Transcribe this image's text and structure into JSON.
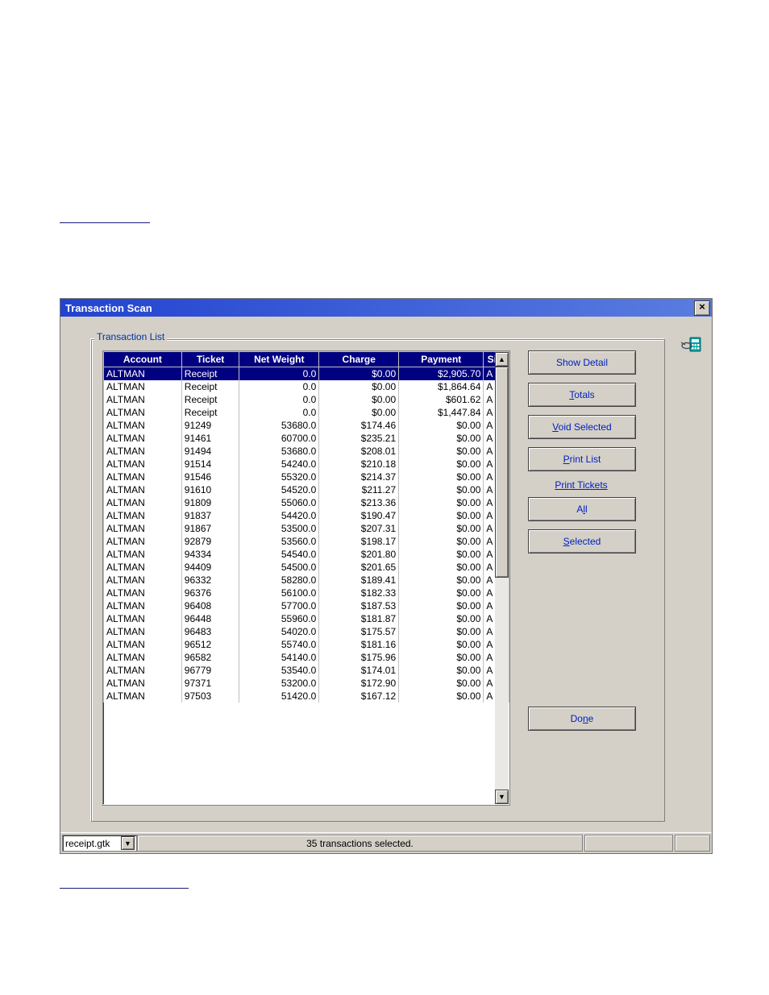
{
  "window": {
    "title": "Transaction Scan",
    "group_label": "Transaction List"
  },
  "columns": {
    "account": "Account",
    "ticket": "Ticket",
    "netweight": "Net Weight",
    "charge": "Charge",
    "payment": "Payment",
    "site": "Site"
  },
  "rows": [
    {
      "selected": true,
      "account": "ALTMAN",
      "ticket": "Receipt",
      "netwt": "0.0",
      "charge": "$0.00",
      "payment": "$2,905.70",
      "site": "A"
    },
    {
      "selected": false,
      "account": "ALTMAN",
      "ticket": "Receipt",
      "netwt": "0.0",
      "charge": "$0.00",
      "payment": "$1,864.64",
      "site": "A"
    },
    {
      "selected": false,
      "account": "ALTMAN",
      "ticket": "Receipt",
      "netwt": "0.0",
      "charge": "$0.00",
      "payment": "$601.62",
      "site": "A"
    },
    {
      "selected": false,
      "account": "ALTMAN",
      "ticket": "Receipt",
      "netwt": "0.0",
      "charge": "$0.00",
      "payment": "$1,447.84",
      "site": "A"
    },
    {
      "selected": false,
      "account": "ALTMAN",
      "ticket": "91249",
      "netwt": "53680.0",
      "charge": "$174.46",
      "payment": "$0.00",
      "site": "A"
    },
    {
      "selected": false,
      "account": "ALTMAN",
      "ticket": "91461",
      "netwt": "60700.0",
      "charge": "$235.21",
      "payment": "$0.00",
      "site": "A"
    },
    {
      "selected": false,
      "account": "ALTMAN",
      "ticket": "91494",
      "netwt": "53680.0",
      "charge": "$208.01",
      "payment": "$0.00",
      "site": "A"
    },
    {
      "selected": false,
      "account": "ALTMAN",
      "ticket": "91514",
      "netwt": "54240.0",
      "charge": "$210.18",
      "payment": "$0.00",
      "site": "A"
    },
    {
      "selected": false,
      "account": "ALTMAN",
      "ticket": "91546",
      "netwt": "55320.0",
      "charge": "$214.37",
      "payment": "$0.00",
      "site": "A"
    },
    {
      "selected": false,
      "account": "ALTMAN",
      "ticket": "91610",
      "netwt": "54520.0",
      "charge": "$211.27",
      "payment": "$0.00",
      "site": "A"
    },
    {
      "selected": false,
      "account": "ALTMAN",
      "ticket": "91809",
      "netwt": "55060.0",
      "charge": "$213.36",
      "payment": "$0.00",
      "site": "A"
    },
    {
      "selected": false,
      "account": "ALTMAN",
      "ticket": "91837",
      "netwt": "54420.0",
      "charge": "$190.47",
      "payment": "$0.00",
      "site": "A"
    },
    {
      "selected": false,
      "account": "ALTMAN",
      "ticket": "91867",
      "netwt": "53500.0",
      "charge": "$207.31",
      "payment": "$0.00",
      "site": "A"
    },
    {
      "selected": false,
      "account": "ALTMAN",
      "ticket": "92879",
      "netwt": "53560.0",
      "charge": "$198.17",
      "payment": "$0.00",
      "site": "A"
    },
    {
      "selected": false,
      "account": "ALTMAN",
      "ticket": "94334",
      "netwt": "54540.0",
      "charge": "$201.80",
      "payment": "$0.00",
      "site": "A"
    },
    {
      "selected": false,
      "account": "ALTMAN",
      "ticket": "94409",
      "netwt": "54500.0",
      "charge": "$201.65",
      "payment": "$0.00",
      "site": "A"
    },
    {
      "selected": false,
      "account": "ALTMAN",
      "ticket": "96332",
      "netwt": "58280.0",
      "charge": "$189.41",
      "payment": "$0.00",
      "site": "A"
    },
    {
      "selected": false,
      "account": "ALTMAN",
      "ticket": "96376",
      "netwt": "56100.0",
      "charge": "$182.33",
      "payment": "$0.00",
      "site": "A"
    },
    {
      "selected": false,
      "account": "ALTMAN",
      "ticket": "96408",
      "netwt": "57700.0",
      "charge": "$187.53",
      "payment": "$0.00",
      "site": "A"
    },
    {
      "selected": false,
      "account": "ALTMAN",
      "ticket": "96448",
      "netwt": "55960.0",
      "charge": "$181.87",
      "payment": "$0.00",
      "site": "A"
    },
    {
      "selected": false,
      "account": "ALTMAN",
      "ticket": "96483",
      "netwt": "54020.0",
      "charge": "$175.57",
      "payment": "$0.00",
      "site": "A"
    },
    {
      "selected": false,
      "account": "ALTMAN",
      "ticket": "96512",
      "netwt": "55740.0",
      "charge": "$181.16",
      "payment": "$0.00",
      "site": "A"
    },
    {
      "selected": false,
      "account": "ALTMAN",
      "ticket": "96582",
      "netwt": "54140.0",
      "charge": "$175.96",
      "payment": "$0.00",
      "site": "A"
    },
    {
      "selected": false,
      "account": "ALTMAN",
      "ticket": "96779",
      "netwt": "53540.0",
      "charge": "$174.01",
      "payment": "$0.00",
      "site": "A"
    },
    {
      "selected": false,
      "account": "ALTMAN",
      "ticket": "97371",
      "netwt": "53200.0",
      "charge": "$172.90",
      "payment": "$0.00",
      "site": "A"
    },
    {
      "selected": false,
      "account": "ALTMAN",
      "ticket": "97503",
      "netwt": "51420.0",
      "charge": "$167.12",
      "payment": "$0.00",
      "site": "A"
    }
  ],
  "buttons": {
    "show_detail": "Show Detail",
    "totals_pre": "",
    "totals_u": "T",
    "totals_post": "otals",
    "void_u": "V",
    "void_post": "oid Selected",
    "print_list_u": "P",
    "print_list_post": "rint List",
    "print_tickets_label": "Print Tickets",
    "all_pre": "A",
    "all_u": "l",
    "all_post": "l",
    "selected_u": "S",
    "selected_post": "elected",
    "done_pre": "Do",
    "done_u": "n",
    "done_post": "e"
  },
  "status": {
    "file": "receipt.gtk",
    "main": "35 transactions selected."
  }
}
